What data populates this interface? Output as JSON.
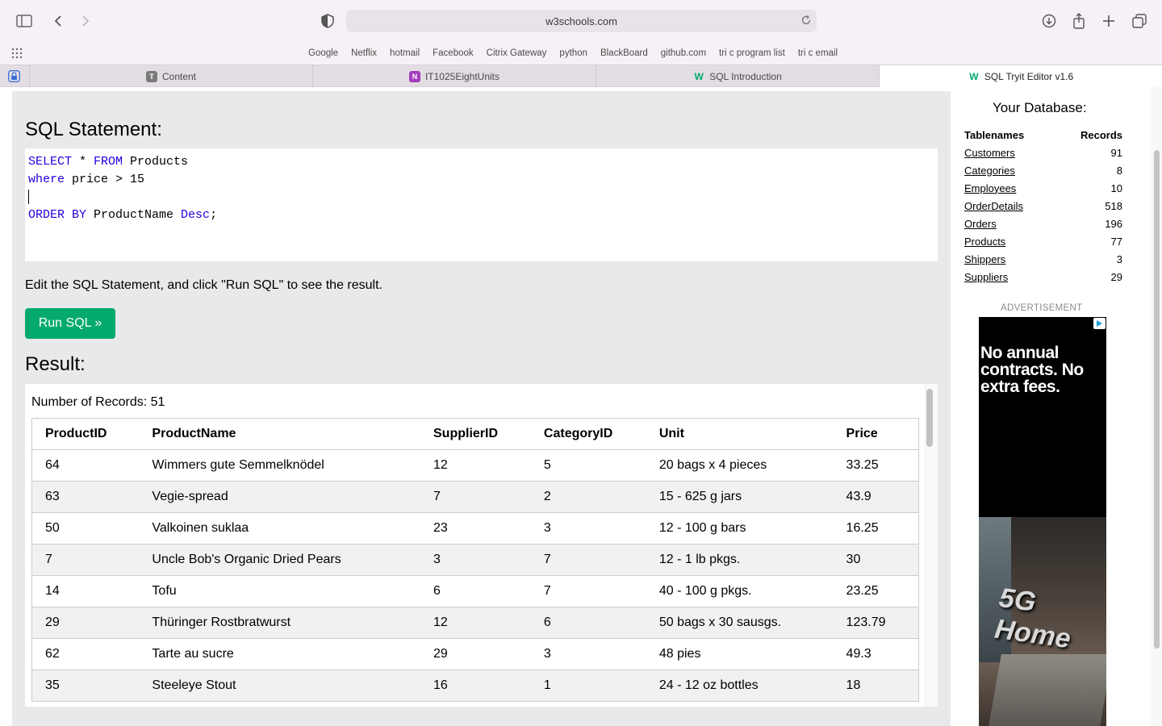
{
  "browser": {
    "address": "w3schools.com",
    "bookmarks": [
      "Google",
      "Netflix",
      "hotmail",
      "Facebook",
      "Citrix Gateway",
      "python",
      "BlackBoard",
      "github.com",
      "tri c program list",
      "tri c email"
    ],
    "tabs": [
      {
        "label": "Content",
        "icon": "T"
      },
      {
        "label": "IT1025EightUnits",
        "icon": "N"
      },
      {
        "label": "SQL Introduction",
        "icon": "W"
      },
      {
        "label": "SQL Tryit Editor v1.6",
        "icon": "W"
      }
    ]
  },
  "editor": {
    "heading": "SQL Statement:",
    "line1_kw1": "SELECT",
    "line1_rest1": " * ",
    "line1_kw2": "FROM",
    "line1_rest2": " Products",
    "line2_kw": "where",
    "line2_rest": " price > 15",
    "line4_kw1": "ORDER BY",
    "line4_rest1": " ProductName ",
    "line4_kw2": "Desc",
    "line4_rest2": ";",
    "hint": "Edit the SQL Statement, and click \"Run SQL\" to see the result.",
    "run_label": "Run SQL »"
  },
  "result": {
    "heading": "Result:",
    "count": "Number of Records: 51",
    "columns": [
      "ProductID",
      "ProductName",
      "SupplierID",
      "CategoryID",
      "Unit",
      "Price"
    ],
    "rows": [
      [
        "64",
        "Wimmers gute Semmelknödel",
        "12",
        "5",
        "20 bags x 4 pieces",
        "33.25"
      ],
      [
        "63",
        "Vegie-spread",
        "7",
        "2",
        "15 - 625 g jars",
        "43.9"
      ],
      [
        "50",
        "Valkoinen suklaa",
        "23",
        "3",
        "12 - 100 g bars",
        "16.25"
      ],
      [
        "7",
        "Uncle Bob's Organic Dried Pears",
        "3",
        "7",
        "12 - 1 lb pkgs.",
        "30"
      ],
      [
        "14",
        "Tofu",
        "6",
        "7",
        "40 - 100 g pkgs.",
        "23.25"
      ],
      [
        "29",
        "Thüringer Rostbratwurst",
        "12",
        "6",
        "50 bags x 30 sausgs.",
        "123.79"
      ],
      [
        "62",
        "Tarte au sucre",
        "29",
        "3",
        "48 pies",
        "49.3"
      ],
      [
        "35",
        "Steeleye Stout",
        "16",
        "1",
        "24 - 12 oz bottles",
        "18"
      ]
    ]
  },
  "sidebar": {
    "title": "Your Database:",
    "col_name": "Tablenames",
    "col_records": "Records",
    "tables": [
      {
        "name": "Customers",
        "records": "91"
      },
      {
        "name": "Categories",
        "records": "8"
      },
      {
        "name": "Employees",
        "records": "10"
      },
      {
        "name": "OrderDetails",
        "records": "518"
      },
      {
        "name": "Orders",
        "records": "196"
      },
      {
        "name": "Products",
        "records": "77"
      },
      {
        "name": "Shippers",
        "records": "3"
      },
      {
        "name": "Suppliers",
        "records": "29"
      }
    ],
    "ad_label": "ADVERTISEMENT",
    "ad_text": "No annual contracts. No extra fees.",
    "ad_5g": "5G Home"
  },
  "colors": {
    "accent": "#04aa6d",
    "keyword": "#2200dd"
  }
}
